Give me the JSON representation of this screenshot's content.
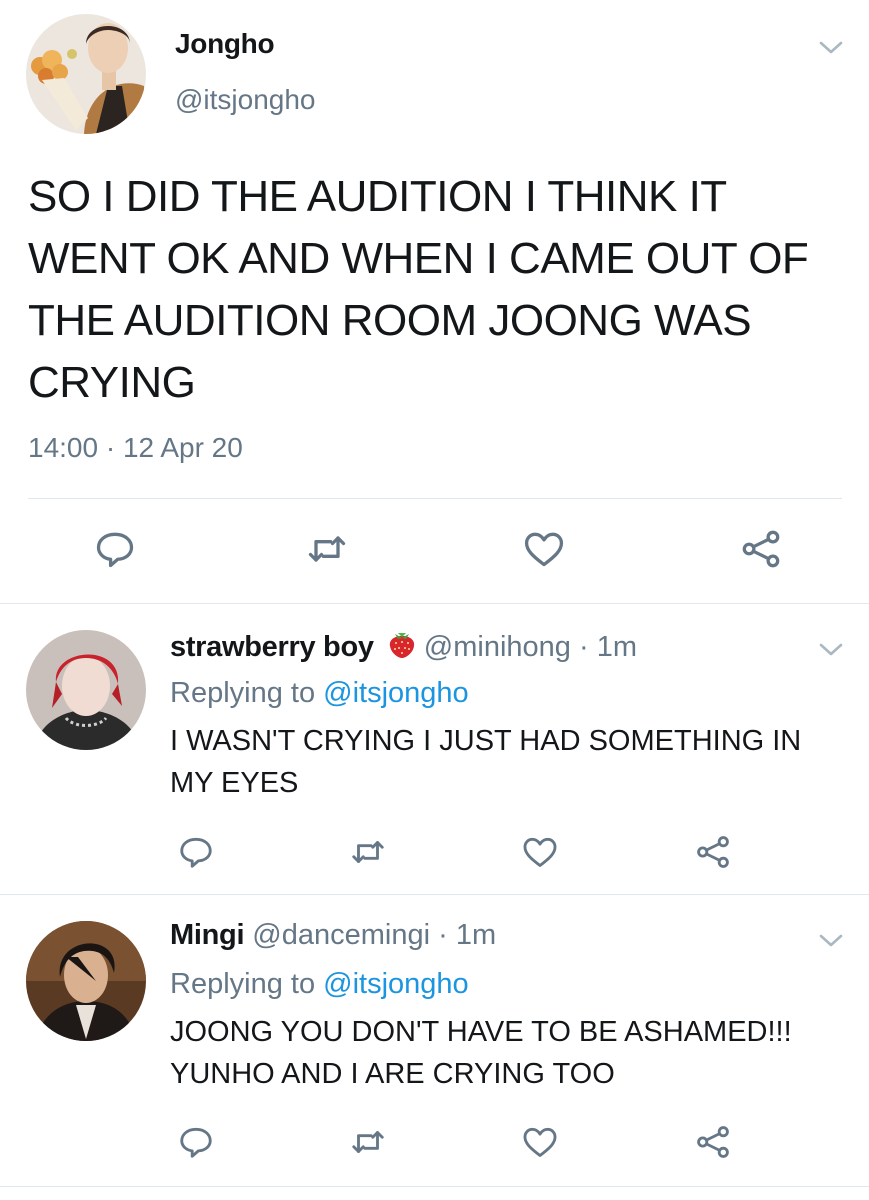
{
  "main_tweet": {
    "author_name": "Jongho",
    "author_handle": "@itsjongho",
    "text": "SO I DID THE AUDITION I THINK IT WENT OK AND WHEN I CAME OUT OF THE AUDITION ROOM JOONG WAS CRYING",
    "timestamp": "14:00 · 12 Apr 20"
  },
  "replies": [
    {
      "author_name": "strawberry boy",
      "author_emoji_icon": "strawberry-icon",
      "author_handle": "@minihong",
      "separator": "·",
      "time": "1m",
      "replying_prefix": "Replying to",
      "replying_to": "@itsjongho",
      "text": "I WASN'T CRYING I JUST HAD SOMETHING IN MY EYES"
    },
    {
      "author_name": "Mingi",
      "author_handle": "@dancemingi",
      "separator": "·",
      "time": "1m",
      "replying_prefix": "Replying to",
      "replying_to": "@itsjongho",
      "text": "JOONG YOU DON'T HAVE TO BE ASHAMED!!! YUNHO AND I ARE CRYING TOO"
    }
  ],
  "icons": {
    "reply": "reply-icon",
    "retweet": "retweet-icon",
    "like": "heart-icon",
    "share": "share-icon",
    "more": "chevron-down-icon"
  },
  "colors": {
    "text": "#14171a",
    "secondary": "#657786",
    "link": "#1b95e0",
    "divider": "#e1e8ed",
    "icon": "#657786"
  }
}
